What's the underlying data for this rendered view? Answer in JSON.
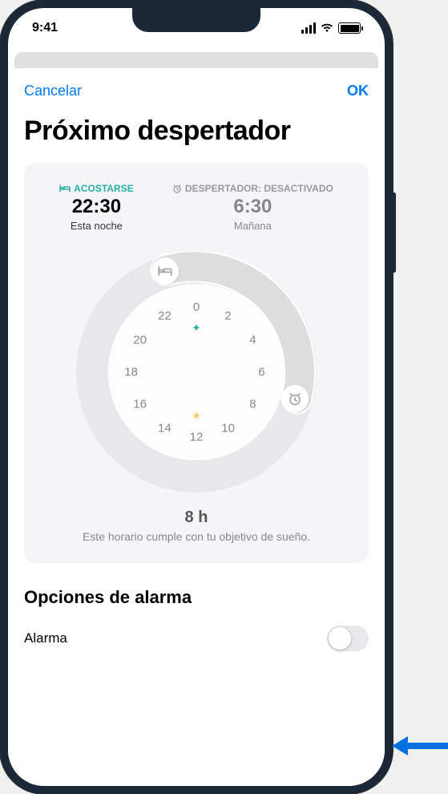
{
  "status": {
    "time": "9:41"
  },
  "modal": {
    "cancel": "Cancelar",
    "ok": "OK",
    "title": "Próximo despertador"
  },
  "schedule": {
    "bedtime": {
      "label": "ACOSTARSE",
      "time": "22:30",
      "sub": "Esta noche"
    },
    "wakeup": {
      "label": "DESPERTADOR: DESACTIVADO",
      "time": "6:30",
      "sub": "Mañana"
    },
    "clock_hours": [
      "0",
      "2",
      "4",
      "6",
      "8",
      "10",
      "12",
      "14",
      "16",
      "18",
      "20",
      "22"
    ],
    "duration": "8 h",
    "duration_desc": "Este horario cumple con tu objetivo de sueño."
  },
  "options": {
    "title": "Opciones de alarma",
    "alarm_label": "Alarma",
    "alarm_on": false
  },
  "colors": {
    "accent": "#007AFF",
    "teal": "#2aafa3"
  },
  "chart_data": {
    "type": "other",
    "bedtime_hour": 22.5,
    "wake_hour": 6.5,
    "duration_hours": 8
  }
}
